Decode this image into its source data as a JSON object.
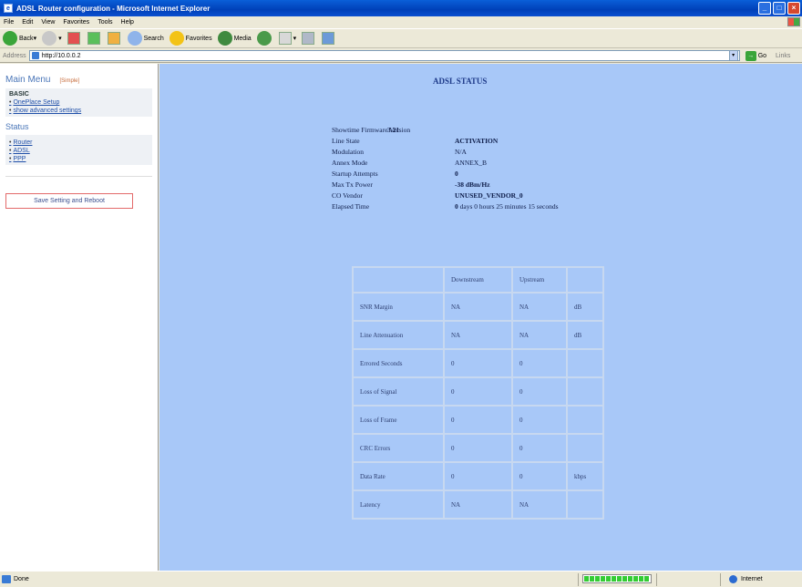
{
  "window": {
    "title": "ADSL Router configuration - Microsoft Internet Explorer"
  },
  "menubar": [
    "File",
    "Edit",
    "View",
    "Favorites",
    "Tools",
    "Help"
  ],
  "toolbar": {
    "back": "Back",
    "search": "Search",
    "favorites": "Favorites",
    "media": "Media"
  },
  "address": {
    "label": "Address",
    "url": "http://10.0.0.2",
    "go": "Go",
    "links": "Links"
  },
  "sidebar": {
    "title": "Main Menu",
    "simple": "[Simple]",
    "basic_heading": "BASIC",
    "basic_items": [
      "OnePlace Setup",
      "show advanced settings"
    ],
    "status_heading": "Status",
    "status_items": [
      "Router",
      "ADSL",
      "PPP"
    ],
    "save_button": "Save Setting and Reboot"
  },
  "main": {
    "title": "ADSL STATUS",
    "info": [
      {
        "label": "Showtime Firmware Version",
        "value": "3.21"
      },
      {
        "label": "Line State",
        "value": "ACTIVATION"
      },
      {
        "label": "Modulation",
        "value": "N/A"
      },
      {
        "label": "Annex Mode",
        "value": "ANNEX_B"
      },
      {
        "label": "Startup Attempts",
        "value": "0"
      },
      {
        "label": "Max Tx Power",
        "value": "-38 dBm/Hz"
      },
      {
        "label": "CO Vendor",
        "value": "UNUSED_VENDOR_0"
      },
      {
        "label": "Elapsed Time",
        "value_bold": "0",
        "value_rest": "days 0 hours 25 minutes 15 seconds"
      }
    ],
    "table": {
      "headers": [
        "",
        "Downstream",
        "Upstream",
        ""
      ],
      "rows": [
        [
          "SNR Margin",
          "NA",
          "NA",
          "dB"
        ],
        [
          "Line Attenuation",
          "NA",
          "NA",
          "dB"
        ],
        [
          "Errored Seconds",
          "0",
          "0",
          ""
        ],
        [
          "Loss of Signal",
          "0",
          "0",
          ""
        ],
        [
          "Loss of Frame",
          "0",
          "0",
          ""
        ],
        [
          "CRC Errors",
          "0",
          "0",
          ""
        ],
        [
          "Data Rate",
          "0",
          "0",
          "kbps"
        ],
        [
          "Latency",
          "NA",
          "NA",
          ""
        ]
      ]
    }
  },
  "statusbar": {
    "text": "Done",
    "zone": "Internet",
    "progress": 1.0
  }
}
